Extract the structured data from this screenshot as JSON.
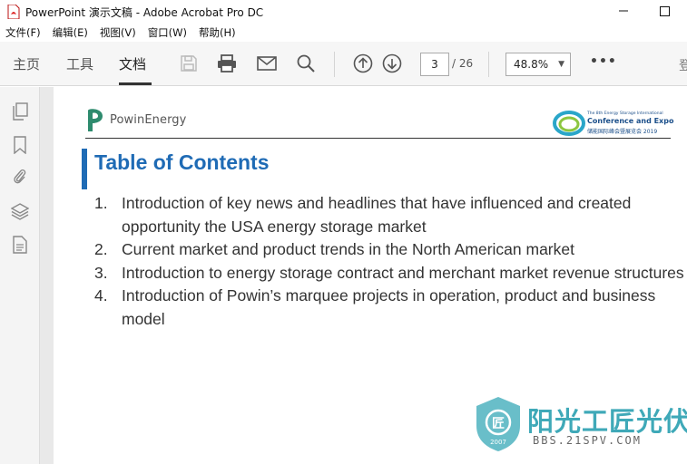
{
  "window": {
    "title": "PowerPoint 演示文稿 - Adobe Acrobat Pro DC"
  },
  "menu": {
    "items": [
      "文件(F)",
      "编辑(E)",
      "视图(V)",
      "窗口(W)",
      "帮助(H)"
    ]
  },
  "toolbar": {
    "tabs": [
      "主页",
      "工具",
      "文档"
    ],
    "active_tab": "文档",
    "page_current": "3",
    "page_total": "/ 26",
    "zoom": "48.8%",
    "more": "•••",
    "signin_partial": "登"
  },
  "document": {
    "company": "PowinEnergy",
    "conference_small": "The 8th Energy Storage International",
    "conference_big": "Conference and Expo",
    "conference_cn": "储能国际峰会暨展览会 2019",
    "title": "Table of Contents",
    "items": [
      {
        "num": "1.",
        "text": "Introduction of key news and headlines that have influenced and created opportunity the USA energy storage market"
      },
      {
        "num": "2.",
        "text": "Current market and product trends in the North American market"
      },
      {
        "num": "3.",
        "text": "Introduction to energy storage contract and merchant market revenue structures"
      },
      {
        "num": "4.",
        "text": "Introduction of Powin’s marquee projects in operation, product and business model"
      }
    ]
  },
  "watermark": {
    "cn": "阳光工匠光伏论坛",
    "url": "BBS.21SPV.COM",
    "year": "2007"
  },
  "colors": {
    "accent": "#1f6bb5",
    "watermark": "#3fa9b8",
    "powin_green": "#2e8b6e"
  }
}
